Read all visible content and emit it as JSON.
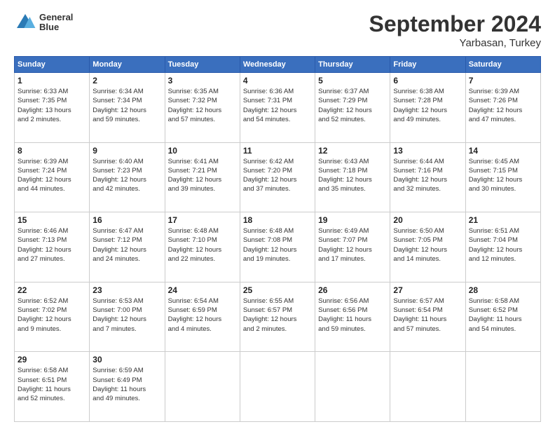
{
  "header": {
    "logo_line1": "General",
    "logo_line2": "Blue",
    "month": "September 2024",
    "location": "Yarbasan, Turkey"
  },
  "weekdays": [
    "Sunday",
    "Monday",
    "Tuesday",
    "Wednesday",
    "Thursday",
    "Friday",
    "Saturday"
  ],
  "weeks": [
    [
      {
        "day": 1,
        "info": "Sunrise: 6:33 AM\nSunset: 7:35 PM\nDaylight: 13 hours\nand 2 minutes."
      },
      {
        "day": 2,
        "info": "Sunrise: 6:34 AM\nSunset: 7:34 PM\nDaylight: 12 hours\nand 59 minutes."
      },
      {
        "day": 3,
        "info": "Sunrise: 6:35 AM\nSunset: 7:32 PM\nDaylight: 12 hours\nand 57 minutes."
      },
      {
        "day": 4,
        "info": "Sunrise: 6:36 AM\nSunset: 7:31 PM\nDaylight: 12 hours\nand 54 minutes."
      },
      {
        "day": 5,
        "info": "Sunrise: 6:37 AM\nSunset: 7:29 PM\nDaylight: 12 hours\nand 52 minutes."
      },
      {
        "day": 6,
        "info": "Sunrise: 6:38 AM\nSunset: 7:28 PM\nDaylight: 12 hours\nand 49 minutes."
      },
      {
        "day": 7,
        "info": "Sunrise: 6:39 AM\nSunset: 7:26 PM\nDaylight: 12 hours\nand 47 minutes."
      }
    ],
    [
      {
        "day": 8,
        "info": "Sunrise: 6:39 AM\nSunset: 7:24 PM\nDaylight: 12 hours\nand 44 minutes."
      },
      {
        "day": 9,
        "info": "Sunrise: 6:40 AM\nSunset: 7:23 PM\nDaylight: 12 hours\nand 42 minutes."
      },
      {
        "day": 10,
        "info": "Sunrise: 6:41 AM\nSunset: 7:21 PM\nDaylight: 12 hours\nand 39 minutes."
      },
      {
        "day": 11,
        "info": "Sunrise: 6:42 AM\nSunset: 7:20 PM\nDaylight: 12 hours\nand 37 minutes."
      },
      {
        "day": 12,
        "info": "Sunrise: 6:43 AM\nSunset: 7:18 PM\nDaylight: 12 hours\nand 35 minutes."
      },
      {
        "day": 13,
        "info": "Sunrise: 6:44 AM\nSunset: 7:16 PM\nDaylight: 12 hours\nand 32 minutes."
      },
      {
        "day": 14,
        "info": "Sunrise: 6:45 AM\nSunset: 7:15 PM\nDaylight: 12 hours\nand 30 minutes."
      }
    ],
    [
      {
        "day": 15,
        "info": "Sunrise: 6:46 AM\nSunset: 7:13 PM\nDaylight: 12 hours\nand 27 minutes."
      },
      {
        "day": 16,
        "info": "Sunrise: 6:47 AM\nSunset: 7:12 PM\nDaylight: 12 hours\nand 24 minutes."
      },
      {
        "day": 17,
        "info": "Sunrise: 6:48 AM\nSunset: 7:10 PM\nDaylight: 12 hours\nand 22 minutes."
      },
      {
        "day": 18,
        "info": "Sunrise: 6:48 AM\nSunset: 7:08 PM\nDaylight: 12 hours\nand 19 minutes."
      },
      {
        "day": 19,
        "info": "Sunrise: 6:49 AM\nSunset: 7:07 PM\nDaylight: 12 hours\nand 17 minutes."
      },
      {
        "day": 20,
        "info": "Sunrise: 6:50 AM\nSunset: 7:05 PM\nDaylight: 12 hours\nand 14 minutes."
      },
      {
        "day": 21,
        "info": "Sunrise: 6:51 AM\nSunset: 7:04 PM\nDaylight: 12 hours\nand 12 minutes."
      }
    ],
    [
      {
        "day": 22,
        "info": "Sunrise: 6:52 AM\nSunset: 7:02 PM\nDaylight: 12 hours\nand 9 minutes."
      },
      {
        "day": 23,
        "info": "Sunrise: 6:53 AM\nSunset: 7:00 PM\nDaylight: 12 hours\nand 7 minutes."
      },
      {
        "day": 24,
        "info": "Sunrise: 6:54 AM\nSunset: 6:59 PM\nDaylight: 12 hours\nand 4 minutes."
      },
      {
        "day": 25,
        "info": "Sunrise: 6:55 AM\nSunset: 6:57 PM\nDaylight: 12 hours\nand 2 minutes."
      },
      {
        "day": 26,
        "info": "Sunrise: 6:56 AM\nSunset: 6:56 PM\nDaylight: 11 hours\nand 59 minutes."
      },
      {
        "day": 27,
        "info": "Sunrise: 6:57 AM\nSunset: 6:54 PM\nDaylight: 11 hours\nand 57 minutes."
      },
      {
        "day": 28,
        "info": "Sunrise: 6:58 AM\nSunset: 6:52 PM\nDaylight: 11 hours\nand 54 minutes."
      }
    ],
    [
      {
        "day": 29,
        "info": "Sunrise: 6:58 AM\nSunset: 6:51 PM\nDaylight: 11 hours\nand 52 minutes."
      },
      {
        "day": 30,
        "info": "Sunrise: 6:59 AM\nSunset: 6:49 PM\nDaylight: 11 hours\nand 49 minutes."
      },
      {
        "day": null,
        "info": ""
      },
      {
        "day": null,
        "info": ""
      },
      {
        "day": null,
        "info": ""
      },
      {
        "day": null,
        "info": ""
      },
      {
        "day": null,
        "info": ""
      }
    ]
  ]
}
